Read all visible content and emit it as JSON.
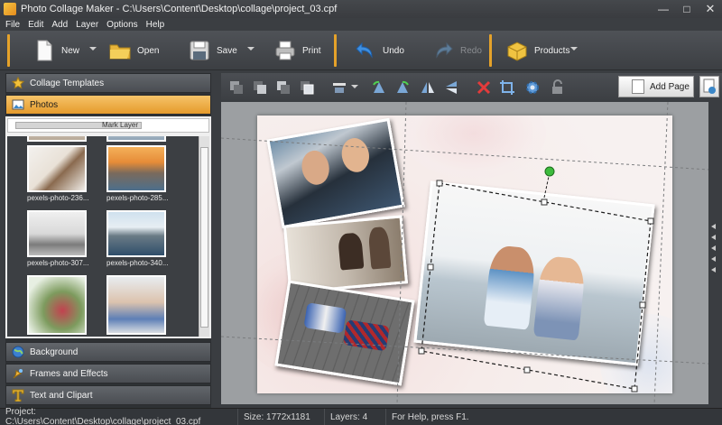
{
  "window": {
    "title": "Photo Collage Maker - C:\\Users\\Content\\Desktop\\collage\\project_03.cpf",
    "minimize_glyph": "—",
    "maximize_glyph": "□",
    "close_glyph": "✕"
  },
  "menu": [
    "File",
    "Edit",
    "Add",
    "Layer",
    "Options",
    "Help"
  ],
  "toolbar": {
    "new": "New",
    "open": "Open",
    "save": "Save",
    "print": "Print",
    "undo": "Undo",
    "redo": "Redo",
    "products": "Products"
  },
  "left_panel": {
    "collage_templates": "Collage Templates",
    "photos": "Photos",
    "mark_layer": "Mark Layer",
    "thumbnails": [
      {
        "caption": "pexels-photo-236..."
      },
      {
        "caption": "pexels-photo-285..."
      },
      {
        "caption": "pexels-photo-307..."
      },
      {
        "caption": "pexels-photo-340..."
      }
    ],
    "background": "Background",
    "frames_effects": "Frames and Effects",
    "text_clipart": "Text and Clipart"
  },
  "editor": {
    "add_page": "Add Page"
  },
  "status": {
    "project": "Project:  C:\\Users\\Content\\Desktop\\collage\\project_03.cpf",
    "size": "Size: 1772x1181",
    "layers": "Layers: 4",
    "help": "For Help, press F1."
  },
  "colors": {
    "accent": "#e59a2b",
    "selection_handle": "#3dbb3d"
  }
}
